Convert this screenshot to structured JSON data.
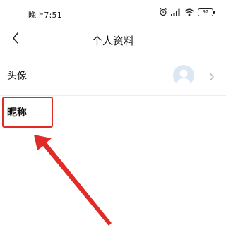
{
  "status_bar": {
    "time": "晚上7:51",
    "battery_level": "92",
    "icons": [
      "alarm-icon",
      "signal-icon",
      "wifi-icon",
      "battery-icon"
    ]
  },
  "nav": {
    "back_icon": "chevron-left-icon",
    "title": "个人资料"
  },
  "profile_rows": {
    "avatar_label": "头像",
    "avatar_icon": "user-placeholder-icon",
    "avatar_chevron": "chevron-right-icon",
    "nickname_label": "昵称"
  },
  "annotation": {
    "color": "#e22b26",
    "highlighted_item": "昵称"
  }
}
